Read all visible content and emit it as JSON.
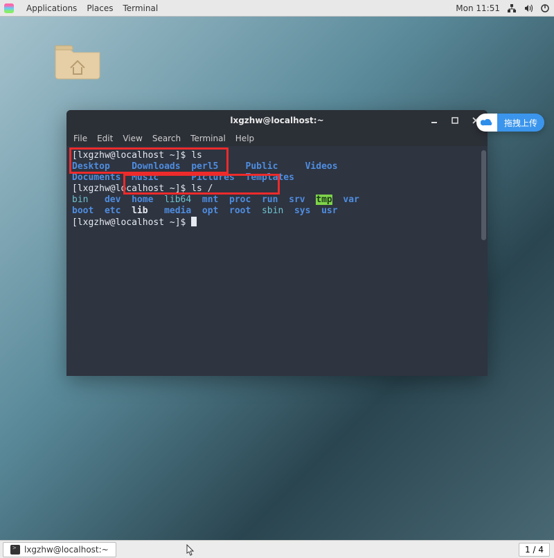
{
  "topbar": {
    "menus": {
      "applications": "Applications",
      "places": "Places",
      "terminal": "Terminal"
    },
    "clock": "Mon 11:51"
  },
  "desktop": {
    "folder_name": "Home"
  },
  "window": {
    "title": "lxgzhw@localhost:~",
    "menubar": {
      "file": "File",
      "edit": "Edit",
      "view": "View",
      "search": "Search",
      "terminal": "Terminal",
      "help": "Help"
    }
  },
  "terminal": {
    "prompt1": "[lxgzhw@localhost ~]$ ",
    "cmd1": "ls",
    "row2_a": "Desktop",
    "row2_b": "Downloads",
    "row2_c": "perl5",
    "row2_d": "Public",
    "row2_e": "Videos",
    "row3_a": "Documents",
    "row3_b": "Music",
    "row3_c": "Pictures",
    "row3_d": "Templates",
    "prompt2": "[lxgzhw@localhost ~]$ ",
    "cmd2": "ls /",
    "root_row1": {
      "a": "bin",
      "b": "dev",
      "c": "home",
      "d": "lib64",
      "e": "mnt",
      "f": "proc",
      "g": "run",
      "h": "srv",
      "i": "tmp",
      "j": "var"
    },
    "root_row2": {
      "a": "boot",
      "b": "etc",
      "c": "lib",
      "d": "media",
      "e": "opt",
      "f": "root",
      "g": "sbin",
      "h": "sys",
      "i": "usr"
    },
    "prompt3": "[lxgzhw@localhost ~]$ "
  },
  "upload": {
    "label": "拖拽上传"
  },
  "taskbar": {
    "task1": "lxgzhw@localhost:~",
    "workspaces": "1 / 4"
  }
}
